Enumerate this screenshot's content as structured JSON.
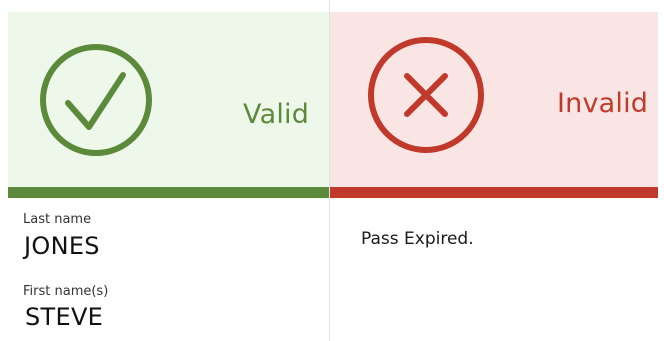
{
  "valid_panel": {
    "status_label": "Valid",
    "status_color": "#5b8a3a",
    "background_color": "#eef8ea",
    "icon": "check-circle-icon",
    "fields": [
      {
        "label": "Last name",
        "value": "JONES"
      },
      {
        "label": "First name(s)",
        "value": "STEVE"
      }
    ]
  },
  "invalid_panel": {
    "status_label": "Invalid",
    "status_color": "#c0392b",
    "background_color": "#f9e6e4",
    "icon": "x-circle-icon",
    "message": "Pass Expired."
  }
}
